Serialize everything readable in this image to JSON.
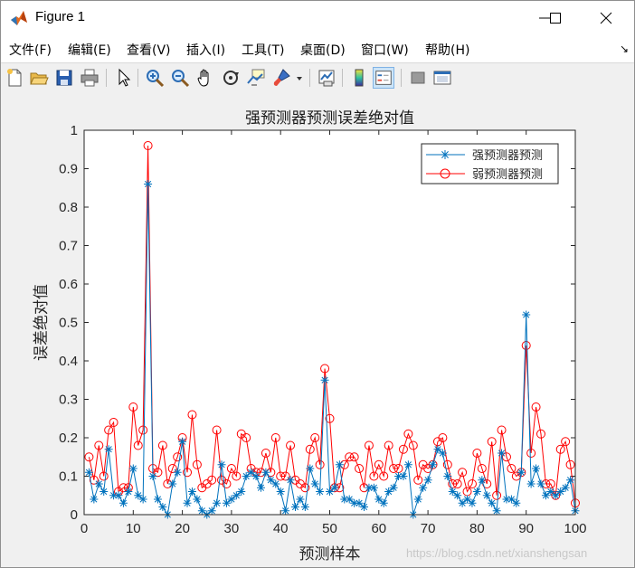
{
  "window": {
    "title": "Figure 1",
    "buttons": [
      "minimize",
      "maximize",
      "close"
    ]
  },
  "menu": {
    "items": [
      "文件(F)",
      "编辑(E)",
      "查看(V)",
      "插入(I)",
      "工具(T)",
      "桌面(D)",
      "窗口(W)",
      "帮助(H)"
    ],
    "dock_arrow": "↘"
  },
  "toolbar": {
    "buttons": [
      "new-figure-icon",
      "open-file-icon",
      "save-icon",
      "print-icon",
      "pointer-icon",
      "zoom-in-icon",
      "zoom-out-icon",
      "pan-hand-icon",
      "rotate-3d-icon",
      "data-cursor-icon",
      "brush-icon",
      "brush-dropdown-icon",
      "link-plot-icon",
      "colorbar-icon",
      "legend-icon",
      "hide-plot-tools-icon",
      "show-plot-tools-icon"
    ]
  },
  "watermark": "https://blog.csdn.net/xianshengsan",
  "chart_data": {
    "type": "line",
    "title": "强预测器预测误差绝对值",
    "xlabel": "预测样本",
    "ylabel": "误差绝对值",
    "xlim": [
      0,
      100
    ],
    "ylim": [
      0,
      1
    ],
    "xticks": [
      "0",
      "10",
      "20",
      "30",
      "40",
      "50",
      "60",
      "70",
      "80",
      "90",
      "100"
    ],
    "yticks": [
      "0",
      "0.1",
      "0.2",
      "0.3",
      "0.4",
      "0.5",
      "0.6",
      "0.7",
      "0.8",
      "0.9",
      "1"
    ],
    "grid": false,
    "legend_position": "top-right",
    "x": [
      1,
      2,
      3,
      4,
      5,
      6,
      7,
      8,
      9,
      10,
      11,
      12,
      13,
      14,
      15,
      16,
      17,
      18,
      19,
      20,
      21,
      22,
      23,
      24,
      25,
      26,
      27,
      28,
      29,
      30,
      31,
      32,
      33,
      34,
      35,
      36,
      37,
      38,
      39,
      40,
      41,
      42,
      43,
      44,
      45,
      46,
      47,
      48,
      49,
      50,
      51,
      52,
      53,
      54,
      55,
      56,
      57,
      58,
      59,
      60,
      61,
      62,
      63,
      64,
      65,
      66,
      67,
      68,
      69,
      70,
      71,
      72,
      73,
      74,
      75,
      76,
      77,
      78,
      79,
      80,
      81,
      82,
      83,
      84,
      85,
      86,
      87,
      88,
      89,
      90,
      91,
      92,
      93,
      94,
      95,
      96,
      97,
      98,
      99,
      100
    ],
    "series": [
      {
        "name": "强预测器预测",
        "color": "#0072bd",
        "marker": "asterisk",
        "values": [
          0.11,
          0.04,
          0.08,
          0.06,
          0.17,
          0.05,
          0.05,
          0.03,
          0.06,
          0.12,
          0.05,
          0.04,
          0.86,
          0.1,
          0.04,
          0.02,
          0.0,
          0.08,
          0.11,
          0.19,
          0.03,
          0.06,
          0.04,
          0.01,
          0.0,
          0.01,
          0.03,
          0.13,
          0.03,
          0.04,
          0.05,
          0.06,
          0.1,
          0.11,
          0.1,
          0.07,
          0.11,
          0.09,
          0.08,
          0.06,
          0.01,
          0.09,
          0.02,
          0.04,
          0.02,
          0.12,
          0.08,
          0.06,
          0.35,
          0.06,
          0.07,
          0.13,
          0.04,
          0.04,
          0.03,
          0.03,
          0.02,
          0.07,
          0.07,
          0.04,
          0.03,
          0.06,
          0.07,
          0.1,
          0.1,
          0.13,
          0.0,
          0.04,
          0.07,
          0.09,
          0.13,
          0.17,
          0.16,
          0.1,
          0.06,
          0.05,
          0.03,
          0.04,
          0.03,
          0.06,
          0.09,
          0.05,
          0.03,
          0.01,
          0.16,
          0.04,
          0.04,
          0.03,
          0.11,
          0.52,
          0.08,
          0.12,
          0.08,
          0.05,
          0.06,
          0.05,
          0.06,
          0.07,
          0.09,
          0.01
        ]
      },
      {
        "name": "弱预测器预测",
        "color": "#ff0000",
        "marker": "circle",
        "values": [
          0.15,
          0.09,
          0.18,
          0.1,
          0.22,
          0.24,
          0.06,
          0.07,
          0.07,
          0.28,
          0.18,
          0.22,
          0.96,
          0.12,
          0.11,
          0.18,
          0.08,
          0.12,
          0.15,
          0.2,
          0.11,
          0.26,
          0.13,
          0.07,
          0.08,
          0.09,
          0.22,
          0.09,
          0.08,
          0.12,
          0.1,
          0.21,
          0.2,
          0.12,
          0.11,
          0.11,
          0.16,
          0.11,
          0.2,
          0.1,
          0.1,
          0.18,
          0.09,
          0.08,
          0.07,
          0.17,
          0.2,
          0.13,
          0.38,
          0.25,
          0.07,
          0.07,
          0.13,
          0.15,
          0.15,
          0.12,
          0.07,
          0.18,
          0.1,
          0.13,
          0.1,
          0.18,
          0.12,
          0.12,
          0.17,
          0.21,
          0.18,
          0.09,
          0.13,
          0.12,
          0.13,
          0.19,
          0.2,
          0.13,
          0.08,
          0.08,
          0.11,
          0.06,
          0.08,
          0.16,
          0.12,
          0.08,
          0.19,
          0.05,
          0.22,
          0.15,
          0.12,
          0.1,
          0.11,
          0.44,
          0.16,
          0.28,
          0.21,
          0.08,
          0.08,
          0.05,
          0.17,
          0.19,
          0.13,
          0.03
        ]
      }
    ]
  }
}
